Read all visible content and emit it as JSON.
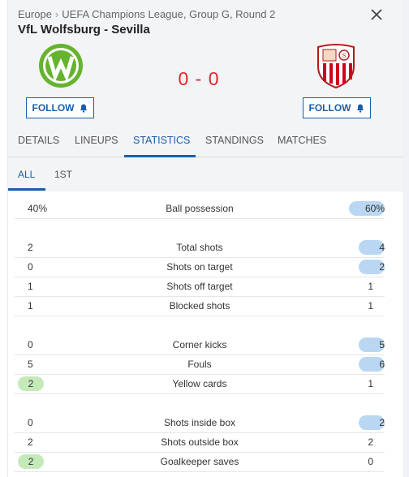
{
  "breadcrumb": {
    "region": "Europe",
    "separator": "›",
    "competition": "UEFA Champions League, Group G, Round 2"
  },
  "match": {
    "home_team": "VfL Wolfsburg",
    "away_team": "Sevilla",
    "title": "VfL Wolfsburg - Sevilla",
    "score": "0 - 0"
  },
  "buttons": {
    "follow_home": "FOLLOW",
    "follow_away": "FOLLOW"
  },
  "tabs": [
    "DETAILS",
    "LINEUPS",
    "STATISTICS",
    "STANDINGS",
    "MATCHES"
  ],
  "active_tab": "STATISTICS",
  "subtabs": [
    "ALL",
    "1ST"
  ],
  "active_subtab": "ALL",
  "stats": [
    {
      "label": "Ball possession",
      "home": "40%",
      "away": "60%",
      "leader": "away"
    },
    {
      "label": "Total shots",
      "home": "2",
      "away": "4",
      "leader": "away"
    },
    {
      "label": "Shots on target",
      "home": "0",
      "away": "2",
      "leader": "away"
    },
    {
      "label": "Shots off target",
      "home": "1",
      "away": "1",
      "leader": "none"
    },
    {
      "label": "Blocked shots",
      "home": "1",
      "away": "1",
      "leader": "none"
    },
    {
      "label": "Corner kicks",
      "home": "0",
      "away": "5",
      "leader": "away"
    },
    {
      "label": "Fouls",
      "home": "5",
      "away": "6",
      "leader": "away"
    },
    {
      "label": "Yellow cards",
      "home": "2",
      "away": "1",
      "leader": "home"
    },
    {
      "label": "Shots inside box",
      "home": "0",
      "away": "2",
      "leader": "away"
    },
    {
      "label": "Shots outside box",
      "home": "2",
      "away": "2",
      "leader": "none"
    },
    {
      "label": "Goalkeeper saves",
      "home": "2",
      "away": "0",
      "leader": "home"
    }
  ],
  "colors": {
    "accent": "#1a5fa8",
    "score": "#e3262a",
    "home_highlight": "#c5e9b9",
    "away_highlight": "#b9d7f2",
    "wolfsburg_green": "#65b32e",
    "sevilla_red": "#d0021b"
  },
  "icons": {
    "close": "close-icon",
    "bell": "bell-icon"
  }
}
